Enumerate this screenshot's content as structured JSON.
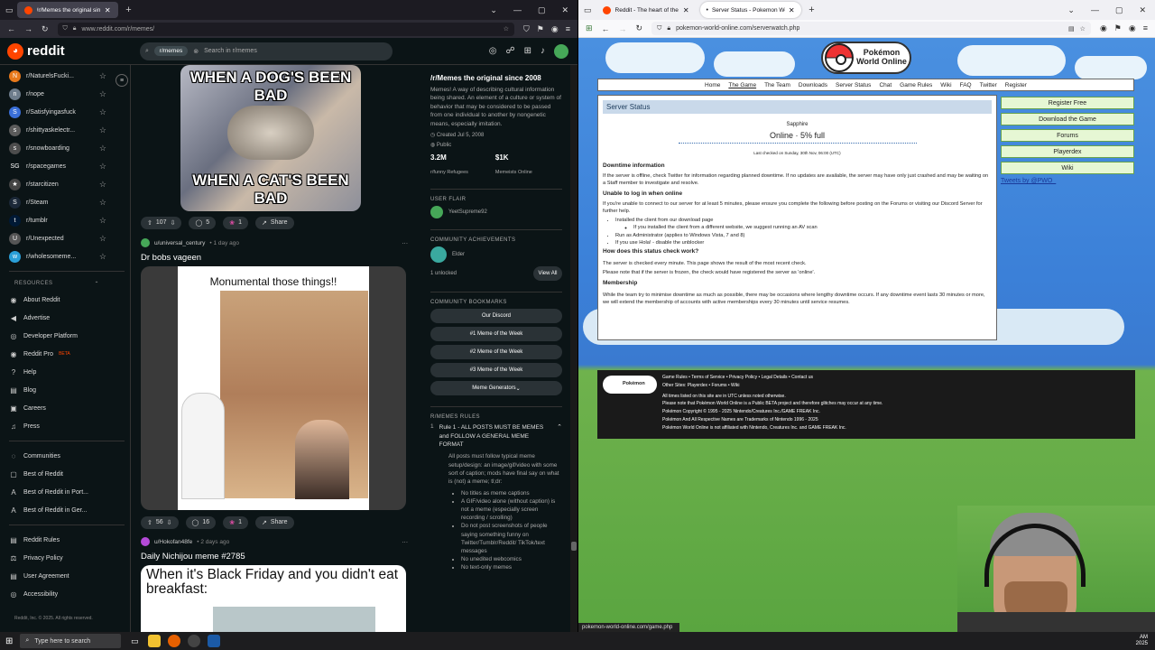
{
  "left": {
    "tab1_title": "/r/Memes the original since 20",
    "url": "www.reddit.com/r/memes/",
    "search_chip": "r/memes",
    "search_placeholder": "Search in r/memes",
    "sidebar_communities": [
      {
        "name": "r/NaturelsFucki...",
        "color": "#e8791b",
        "glyph": "N"
      },
      {
        "name": "r/nope",
        "color": "#6e7d8c",
        "glyph": "n"
      },
      {
        "name": "r/Satisfyingasfuck",
        "color": "#3a6fd9",
        "glyph": "S"
      },
      {
        "name": "r/shittyaskelectr...",
        "color": "#5b5b5b",
        "glyph": "s"
      },
      {
        "name": "r/snowboarding",
        "color": "#4d4d4d",
        "glyph": "s"
      },
      {
        "name": "r/spacegames",
        "color": "transparent",
        "glyph": "SG"
      },
      {
        "name": "r/starcitizen",
        "color": "#444",
        "glyph": "★"
      },
      {
        "name": "r/Steam",
        "color": "#1b2838",
        "glyph": "S"
      },
      {
        "name": "r/tumblr",
        "color": "#001935",
        "glyph": "t"
      },
      {
        "name": "r/Unexpected",
        "color": "#555",
        "glyph": "U"
      },
      {
        "name": "r/wholesomeme...",
        "color": "#2a9fd8",
        "glyph": "w"
      }
    ],
    "resources_title": "RESOURCES",
    "resources": [
      "About Reddit",
      "Advertise",
      "Developer Platform",
      "Reddit Pro",
      "Help",
      "Blog",
      "Careers",
      "Press"
    ],
    "reddit_pro_badge": "BETA",
    "links2": [
      "Communities",
      "Best of Reddit",
      "Best of Reddit in Port...",
      "Best of Reddit in Ger..."
    ],
    "links3": [
      "Reddit Rules",
      "Privacy Policy",
      "User Agreement",
      "Accessibility"
    ],
    "copyright": "Reddit, Inc. © 2025. All rights reserved.",
    "post1": {
      "top_text": "WHEN A DOG'S BEEN BAD",
      "bottom_text": "WHEN A CAT'S BEEN BAD",
      "votes": "107",
      "comments": "5",
      "awards": "1",
      "share": "Share"
    },
    "post2": {
      "user": "u/universal_century",
      "age": "• 1 day ago",
      "title": "Dr bobs vageen",
      "caption": "Monumental those things!!",
      "votes": "56",
      "comments": "16",
      "awards": "1",
      "share": "Share"
    },
    "post3": {
      "user": "u/Hokofan48fe",
      "age": "• 2 days ago",
      "title": "Daily Nichijou meme #2785",
      "caption": "When it's Black Friday and you didn't eat breakfast:"
    },
    "about": {
      "title": "/r/Memes the original since 2008",
      "desc": "Memes! A way of describing cultural information being shared. An element of a culture or system of behavior that may be considered to be passed from one individual to another by nongenetic means, especially imitation.",
      "created": "Created Jul 5, 2008",
      "visibility": "Public",
      "members": "3.2M",
      "members_label": "r/funny Refugees",
      "online": "$1K",
      "online_label": "Memeists Online"
    },
    "user_flair_title": "USER FLAIR",
    "user_flair_name": "YeetSupreme92",
    "achievements_title": "COMMUNITY ACHIEVEMENTS",
    "achievement_name": "Elder",
    "unlocked": "1 unlocked",
    "view_all": "View All",
    "bookmarks_title": "COMMUNITY BOOKMARKS",
    "bookmarks": [
      "Our Discord",
      "#1 Meme of the Week",
      "#2 Meme of the Week",
      "#3 Meme of the Week",
      "Meme Generators"
    ],
    "rules_title": "R/MEMES RULES",
    "rule1": "Rule 1 - ALL POSTS MUST BE MEMES and FOLLOW A GENERAL MEME FORMAT",
    "rule1_desc": "All posts must follow typical meme setup/design: an image/gif/video with some sort of caption; mods have final say on what is (not) a meme; tl;dr:",
    "rule1_list": [
      "No titles as meme captions",
      "A GIF/video alone (without caption) is not a meme (especially screen recording / scrolling)",
      "Do not post screenshots of people saying something funny on Twitter/Tumblr/Reddit/ TikTok/text messages",
      "No unedited webcomics",
      "No text-only memes"
    ]
  },
  "right": {
    "tab1_title": "Reddit - The heart of the intern",
    "tab2_title": "Server Status - Pokemon World",
    "url": "pokemon-world-online.com/serverwatch.php",
    "logo_line1": "Pokémon",
    "logo_line2": "World Online",
    "nav": [
      "Home",
      "The Game",
      "The Team",
      "Downloads",
      "Server Status",
      "Chat",
      "Game Rules",
      "Wiki",
      "FAQ",
      "Twitter",
      "Register"
    ],
    "heading": "Server Status",
    "server_name": "Sapphire",
    "server_status": "Online · 5% full",
    "last_checked": "Last checked on Sunday, 30th Nov, 06:00 (UTC)",
    "downtime_title": "Downtime information",
    "downtime_text": "If the server is offline, check Twitter for information regarding planned downtime. If no updates are available, the server may have only just crashed and may be waiting on a Staff member to investigate and resolve.",
    "login_title": "Unable to log in when online",
    "login_text": "If you're unable to connect to our server for at least 5 minutes, please ensure you complete the following before posting on the Forums or visiting our Discord Server for further help.",
    "login_list": [
      "Installed the client from our download page",
      "If you installed the client from a different website, we suggest running an AV scan",
      "Run as Administrator (applies to Windows Vista, 7 and 8)",
      "If you use Hola! - disable the unblocker"
    ],
    "how_title": "How does this status check work?",
    "how_text1": "The server is checked every minute. This page shows the result of the most recent check.",
    "how_text2": "Please note that if the server is frozen, the check would have registered the server as 'online'.",
    "member_title": "Membership",
    "member_text": "While the team try to minimise downtime as much as possible, there may be occasions where lengthy downtime occurs. If any downtime event lasts 30 minutes or more, we will extend the membership of accounts with active memberships every 30 minutes until service resumes.",
    "side_buttons": [
      "Register Free",
      "Download the Game",
      "Forums",
      "Playerdex",
      "Wiki"
    ],
    "tweets_link": "Tweets by @PWO_",
    "footer_links": "Game Rules • Terms of Service • Privacy Policy • Legal Details • Contact us",
    "footer_other": "Other Sites: Playerdex • Forums • Wiki",
    "footer_lines": [
      "All times listed on this site are in UTC unless noted otherwise.",
      "Please note that Pokémon World Online is a Public BETA project and therefore glitches may occur at any time.",
      "Pokémon Copyright © 1995 - 2025 Nintendo/Creatures Inc./GAME FREAK Inc.",
      "Pokémon And All Respective Names are Trademarks of Nintendo 1996 - 2025",
      "Pokémon World Online is not affiliated with Nintendo, Creatures Inc. and GAME FREAK Inc."
    ],
    "status_url": "pokemon-world-online.com/game.php"
  },
  "taskbar": {
    "search_placeholder": "Type here to search",
    "time": "AM",
    "year": "2025"
  }
}
